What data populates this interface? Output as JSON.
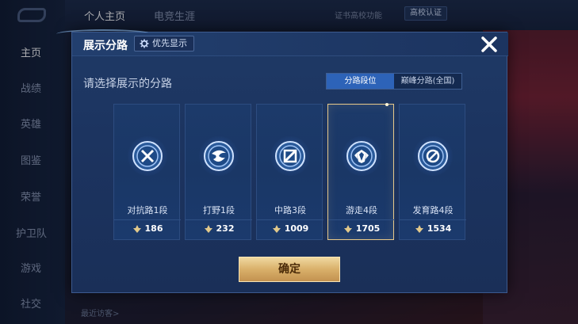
{
  "background": {
    "nav_items": [
      "主页",
      "战绩",
      "英雄",
      "图鉴",
      "荣誉",
      "护卫队",
      "游戏",
      "社交"
    ],
    "top_tabs": [
      "个人主页",
      "电竞生涯"
    ],
    "top_link": "证书高校功能",
    "cert_badge": "高校认证",
    "bottom_text": "最近访客>"
  },
  "modal": {
    "title": "展示分路",
    "priority_label": "优先显示",
    "subtitle": "请选择展示的分路",
    "toggle": [
      "分路段位",
      "巅峰分路(全国)"
    ],
    "confirm_label": "确定"
  },
  "lanes": [
    {
      "name": "对抗路1段",
      "points": "186",
      "icon": "clash-lane-icon",
      "selected": false
    },
    {
      "name": "打野1段",
      "points": "232",
      "icon": "jungle-icon",
      "selected": false
    },
    {
      "name": "中路3段",
      "points": "1009",
      "icon": "mid-lane-icon",
      "selected": false
    },
    {
      "name": "游走4段",
      "points": "1705",
      "icon": "roam-icon",
      "selected": true
    },
    {
      "name": "发育路4段",
      "points": "1534",
      "icon": "farm-lane-icon",
      "selected": false
    }
  ],
  "colors": {
    "accent_gold": "#e8c98a",
    "toggle_active": "#2d63b8",
    "modal_bg": "#1c3460"
  }
}
